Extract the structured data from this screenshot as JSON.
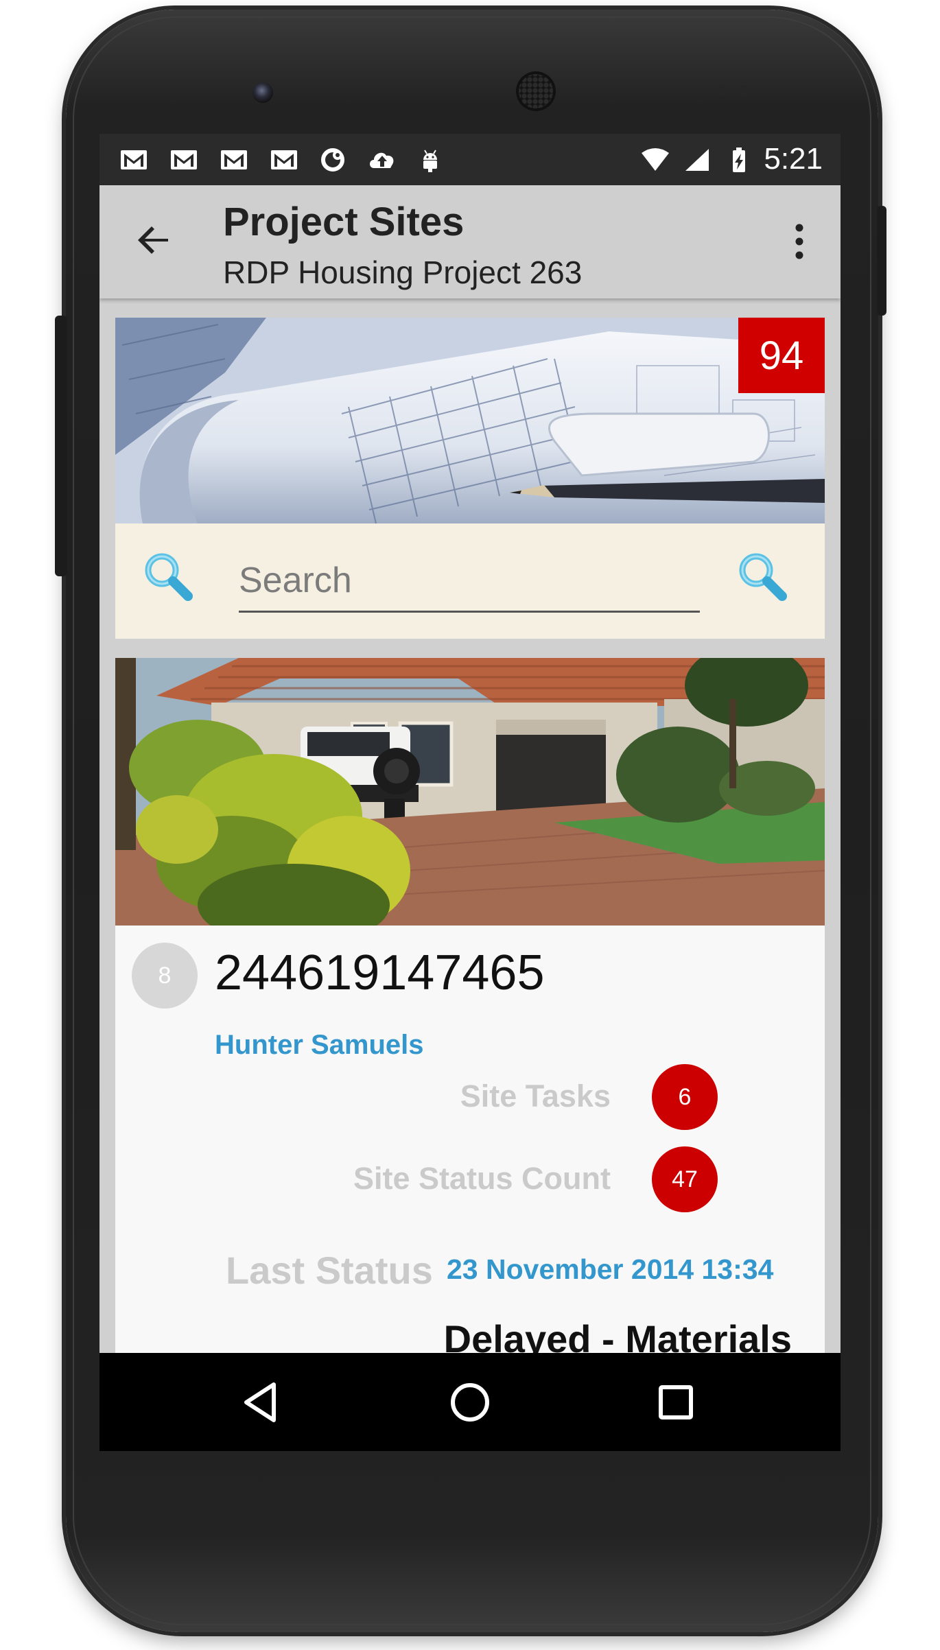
{
  "status_bar": {
    "time": "5:21",
    "notification_icons": [
      "gmail-icon",
      "gmail-icon",
      "gmail-icon",
      "gmail-icon",
      "sync-icon",
      "cloud-upload-icon",
      "android-icon"
    ],
    "system_icons": [
      "wifi-icon",
      "cell-signal-icon",
      "battery-charging-icon"
    ]
  },
  "app_bar": {
    "title": "Project Sites",
    "subtitle": "RDP Housing Project 263"
  },
  "banner": {
    "count_badge": "94"
  },
  "search": {
    "placeholder": "Search",
    "value": ""
  },
  "site_card": {
    "avatar_number": "8",
    "site_number": "244619147465",
    "person": "Hunter Samuels",
    "site_tasks_label": "Site Tasks",
    "site_tasks_count": "6",
    "site_status_count_label": "Site Status Count",
    "site_status_count": "47",
    "last_status_label": "Last Status",
    "last_status_date": "23 November 2014 13:34",
    "last_status_value": "Delayed - Materials"
  },
  "colors": {
    "accent_blue": "#3396cc",
    "badge_red": "#cc0000",
    "app_bar_grey": "#cfcfcf",
    "search_bg": "#f5f0e2"
  }
}
